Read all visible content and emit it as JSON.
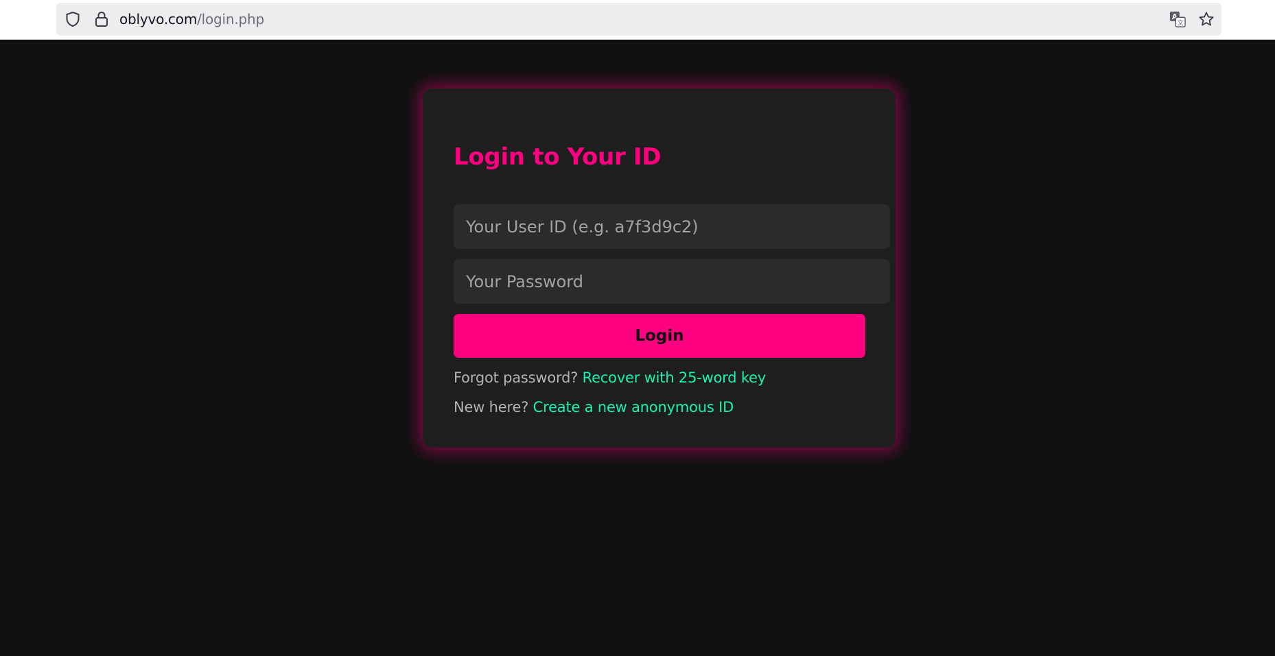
{
  "browser": {
    "url_host": "oblyvo.com",
    "url_path": "/login.php",
    "icons": [
      "shield-icon",
      "lock-icon",
      "translate-icon",
      "star-icon"
    ]
  },
  "login": {
    "title": "Login to Your ID",
    "user_id_placeholder": "Your User ID (e.g. a7f3d9c2)",
    "user_id_value": "",
    "password_placeholder": "Your Password",
    "password_value": "",
    "submit_label": "Login",
    "forgot_prefix": "Forgot password?",
    "forgot_link": "Recover with 25-word key",
    "new_prefix": "New here?",
    "new_link": "Create a new anonymous ID"
  },
  "colors": {
    "accent": "#ff0080",
    "link": "#19f2b1",
    "page_bg": "#111111",
    "card_bg": "#1e1e1e",
    "input_bg": "#2b2b2b"
  }
}
